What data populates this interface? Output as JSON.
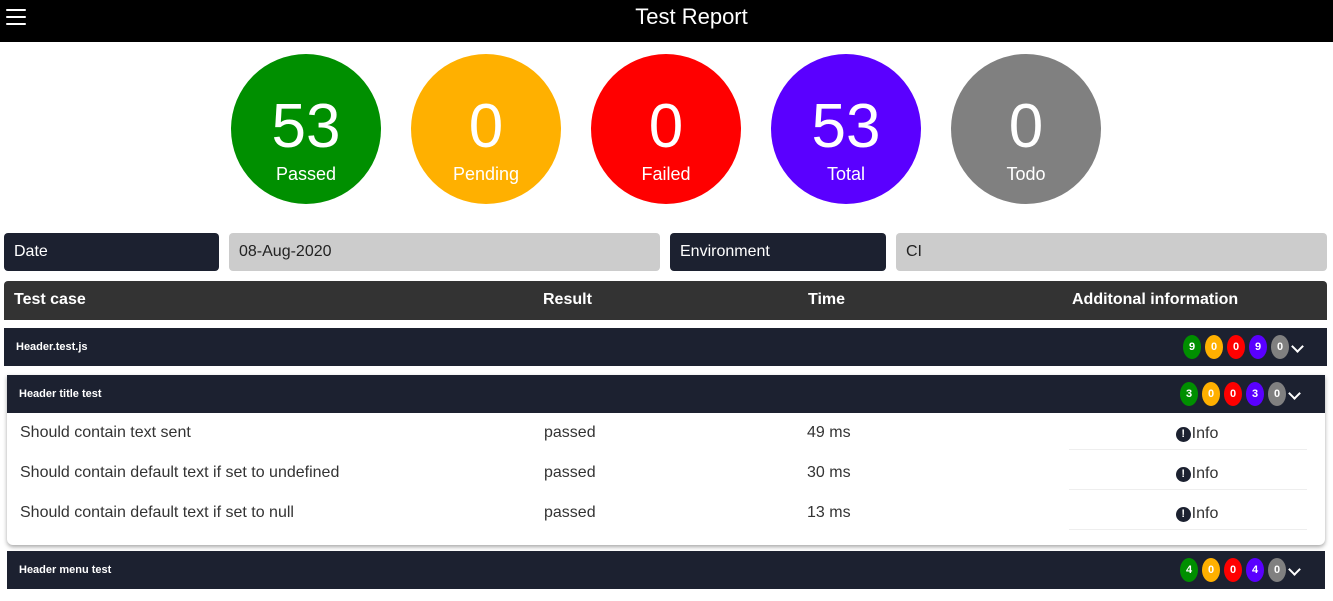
{
  "header": {
    "title": "Test Report",
    "menu_icon": "hamburger-menu-icon"
  },
  "stats": [
    {
      "count": "53",
      "label": "Passed",
      "color": "#008f00"
    },
    {
      "count": "0",
      "label": "Pending",
      "color": "#ffb000"
    },
    {
      "count": "0",
      "label": "Failed",
      "color": "#ff0000"
    },
    {
      "count": "53",
      "label": "Total",
      "color": "#5a00ff"
    },
    {
      "count": "0",
      "label": "Todo",
      "color": "#808080"
    }
  ],
  "meta": {
    "date_label": "Date",
    "date_value": "08-Aug-2020",
    "env_label": "Environment",
    "env_value": "CI"
  },
  "table": {
    "headers": [
      "Test case",
      "Result",
      "Time",
      "Additonal information"
    ]
  },
  "suite": {
    "name": "Header.test.js",
    "badges": [
      "9",
      "0",
      "0",
      "9",
      "0"
    ]
  },
  "groups": [
    {
      "name": "Header title test",
      "badges": [
        "3",
        "0",
        "0",
        "3",
        "0"
      ],
      "tests": [
        {
          "name": "Should contain text sent",
          "result": "passed",
          "time": "49 ms",
          "info": "Info"
        },
        {
          "name": "Should contain default text if set to undefined",
          "result": "passed",
          "time": "30 ms",
          "info": "Info"
        },
        {
          "name": "Should contain default text if set to null",
          "result": "passed",
          "time": "13 ms",
          "info": "Info"
        }
      ]
    },
    {
      "name": "Header menu test",
      "badges": [
        "4",
        "0",
        "0",
        "4",
        "0"
      ]
    }
  ],
  "badge_colors": [
    "#008f00",
    "#ffb000",
    "#ff0000",
    "#5a00ff",
    "#808080"
  ]
}
